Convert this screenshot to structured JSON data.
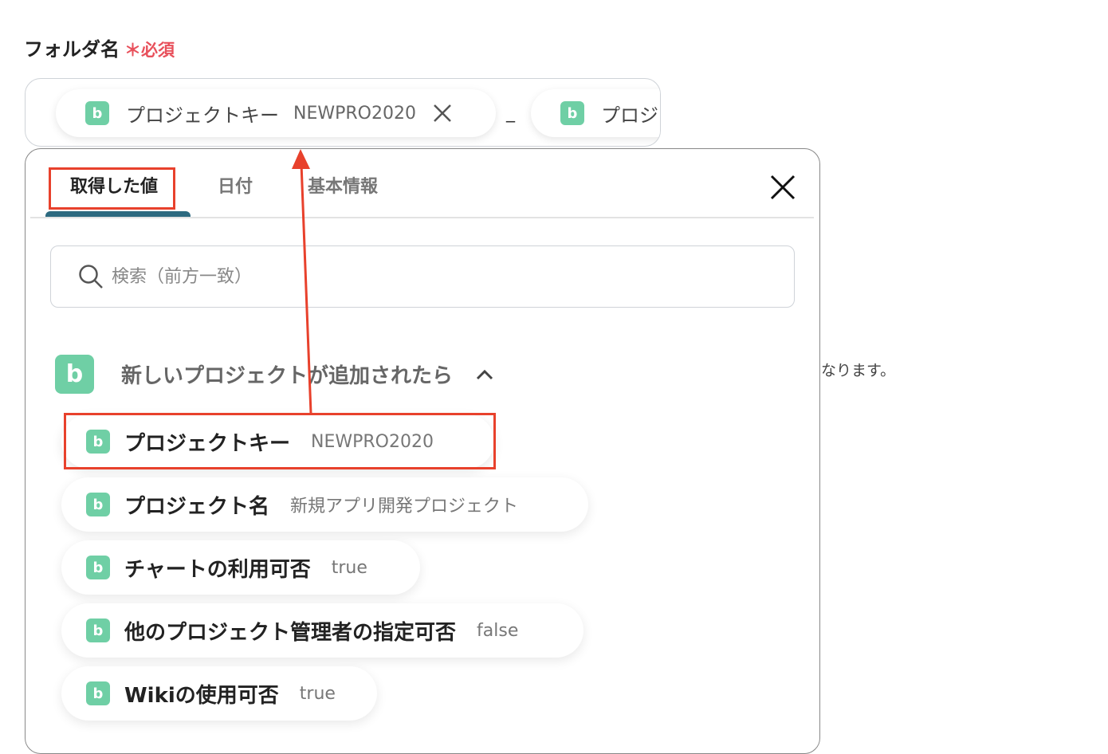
{
  "field": {
    "label": "フォルダ名",
    "required_mark": "＊",
    "required_text": "必須",
    "chips": [
      {
        "icon": "backlog-icon",
        "label": "プロジェクトキー",
        "value": "NEWPRO2020"
      },
      {
        "icon": "backlog-icon",
        "label": "プロジ"
      }
    ],
    "separator": "_"
  },
  "background_note": "なります。",
  "panel": {
    "tabs": [
      {
        "label": "取得した値",
        "active": true
      },
      {
        "label": "日付"
      },
      {
        "label": "基本情報"
      }
    ],
    "search_placeholder": "検索（前方一致）",
    "group": {
      "title": "新しいプロジェクトが追加されたら",
      "expanded": true
    },
    "items": [
      {
        "label": "プロジェクトキー",
        "value": "NEWPRO2020"
      },
      {
        "label": "プロジェクト名",
        "value": "新規アプリ開発プロジェクト"
      },
      {
        "label": "チャートの利用可否",
        "value": "true"
      },
      {
        "label": "他のプロジェクト管理者の指定可否",
        "value": "false"
      },
      {
        "label": "Wikiの使用可否",
        "value": "true"
      }
    ]
  },
  "colors": {
    "accent": "#2d6a80",
    "brand": "#6fcfa5",
    "annotation": "#e8412c",
    "required": "#e8505b"
  }
}
